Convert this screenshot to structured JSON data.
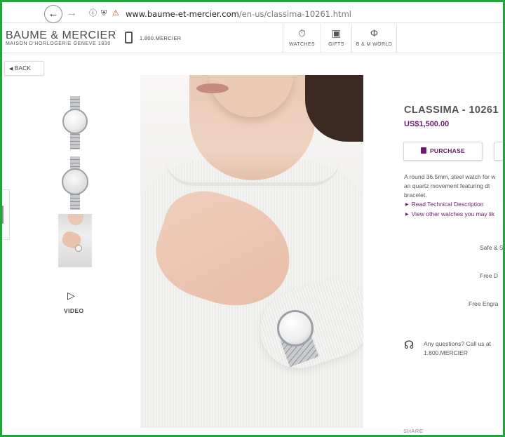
{
  "browser": {
    "back_icon": "arrow-left-icon",
    "forward_icon": "arrow-right-icon",
    "url_domain": "www.baume-et-mercier.com",
    "url_path": "/en-us/classima-10261.html"
  },
  "header": {
    "logo_main": "BAUME & MERCIER",
    "logo_sub": "MAISON D'HORLOGERIE GENEVE 1830",
    "phone": "1.800.MERCIER",
    "nav": [
      {
        "label": "WATCHES",
        "icon": "watch-icon"
      },
      {
        "label": "GIFTS",
        "icon": "gift-icon"
      },
      {
        "label": "B & M WORLD",
        "icon": "phi-icon"
      }
    ]
  },
  "back_button": {
    "label": "BACK"
  },
  "gallery": {
    "video_label": "VIDEO"
  },
  "product": {
    "title": "CLASSIMA - 10261",
    "price": "US$1,500.00",
    "purchase_label": "PURCHASE",
    "description_lines": [
      "A round 36.5mm, steel watch for w",
      "an quartz movement featuring dt",
      "bracelet."
    ],
    "links": [
      "Read Technical Description",
      "View other watches you may lik"
    ],
    "services": [
      "Safe & S",
      "Free D",
      "Free Engra"
    ],
    "help_line1": "Any questions? Call us at",
    "help_line2": "1.800.MERCIER",
    "share_label": "SHARE"
  },
  "colors": {
    "accent": "#6a1b6b",
    "frame": "#1fa83a"
  }
}
